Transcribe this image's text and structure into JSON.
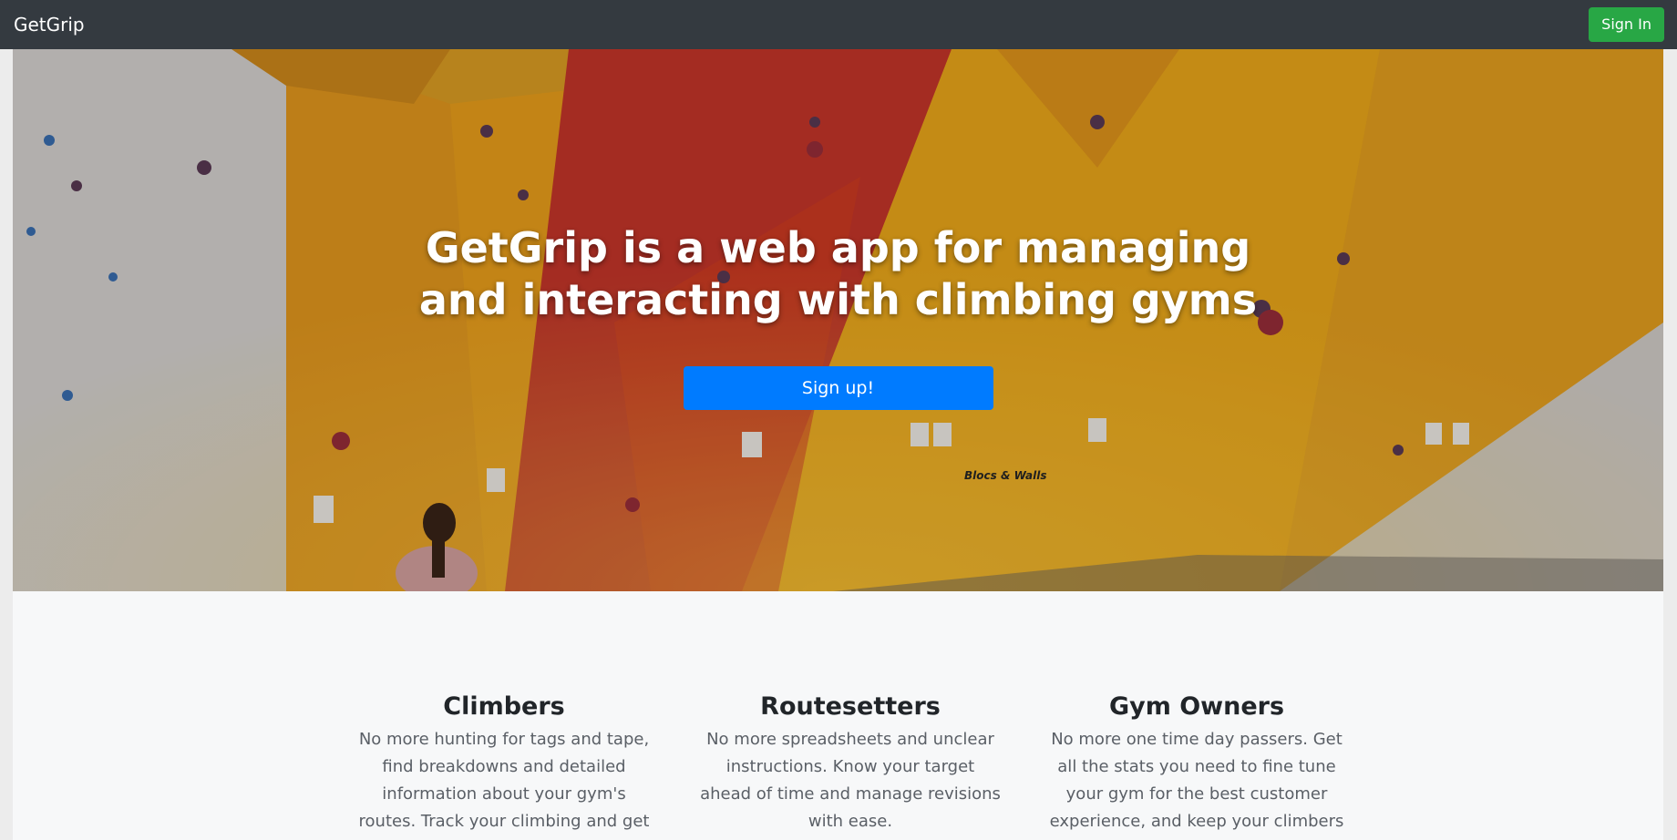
{
  "navbar": {
    "brand": "GetGrip",
    "sign_in_label": "Sign In"
  },
  "hero": {
    "title": "GetGrip is a web app for managing and interacting with climbing gyms",
    "signup_label": "Sign up!",
    "wall_sign": "Blocs & Walls"
  },
  "features": [
    {
      "title": "Climbers",
      "text": "No more hunting for tags and tape, find breakdowns and detailed information about your gym's routes. Track your climbing and get insights"
    },
    {
      "title": "Routesetters",
      "text": "No more spreadsheets and unclear instructions. Know your target ahead of time and manage revisions with ease."
    },
    {
      "title": "Gym Owners",
      "text": "No more one time day passers. Get all the stats you need to fine tune your gym for the best customer experience, and keep your climbers"
    }
  ],
  "colors": {
    "navbar_bg": "#343a40",
    "signin_green": "#28a745",
    "signup_blue": "#007bff"
  }
}
